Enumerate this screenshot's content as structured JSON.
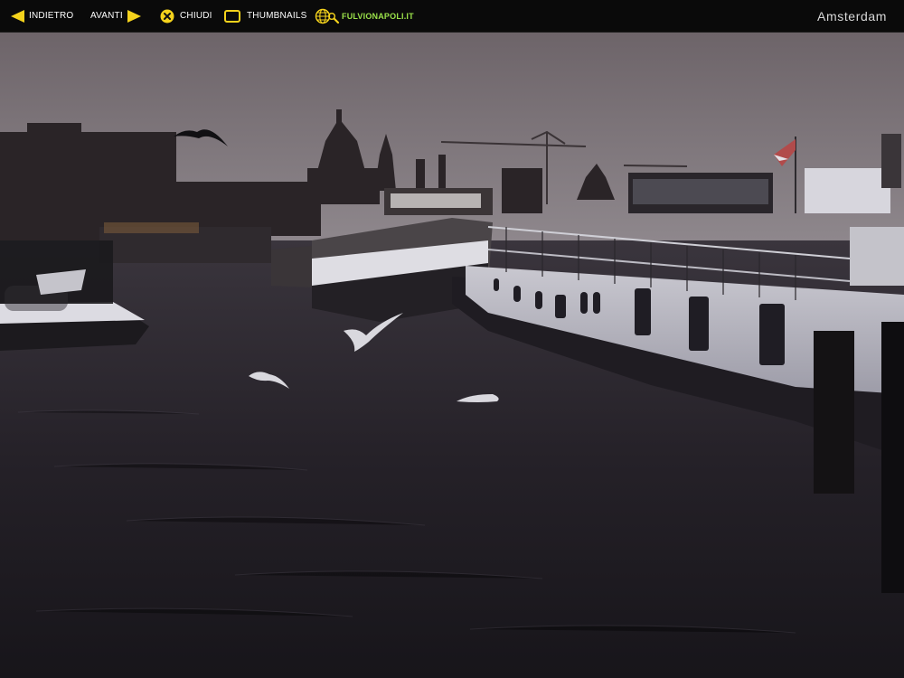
{
  "toolbar": {
    "prev_label": "INDIETRO",
    "next_label": "AVANTI",
    "close_label": "CHIUDI",
    "thumbnails_label": "THUMBNAILS",
    "site_label": "FULVIONAPOLI.IT"
  },
  "gallery": {
    "title": "Amsterdam"
  },
  "icons": {
    "prev": "arrow-left-icon",
    "next": "arrow-right-icon",
    "close": "close-icon",
    "thumbnails": "thumbnails-icon",
    "site": "globe-search-icon"
  },
  "colors": {
    "bar_background": "#0a0a0a",
    "icon_yellow": "#f5d31c",
    "site_link_green": "#9be24a",
    "label_white": "#ffffff"
  }
}
